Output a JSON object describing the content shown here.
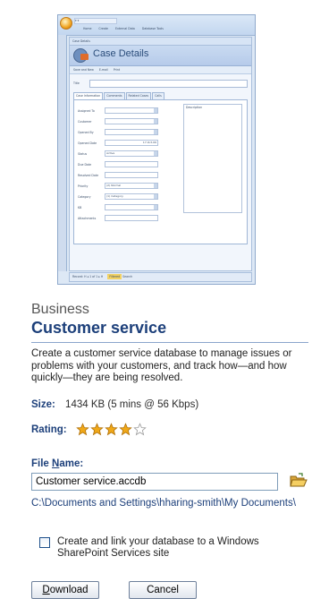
{
  "preview": {
    "quick_access": "▾ ▾",
    "ribbon_tabs": [
      "Home",
      "Create",
      "External Data",
      "Database Tools"
    ],
    "doc_tab": "Case Details",
    "form_title": "Case Details",
    "commands": [
      "Save and New",
      "E-mail",
      "Print"
    ],
    "title_label": "Title",
    "subtabs": [
      "Case Information",
      "Comments",
      "Related Cases",
      "Calls"
    ],
    "fields": [
      {
        "label": "Assigned To",
        "value": "",
        "dropdown": true
      },
      {
        "label": "Customer",
        "value": "",
        "dropdown": true
      },
      {
        "label": "Opened By",
        "value": "",
        "dropdown": true
      },
      {
        "label": "Opened Date",
        "value": "17-Oct-06",
        "dropdown": false
      },
      {
        "label": "Status",
        "value": "Active",
        "dropdown": true
      },
      {
        "label": "Due Date",
        "value": "",
        "dropdown": false
      },
      {
        "label": "Resolved Date",
        "value": "",
        "dropdown": false
      },
      {
        "label": "Priority",
        "value": "(2) Normal",
        "dropdown": true
      },
      {
        "label": "Category",
        "value": "(1) Category",
        "dropdown": true
      },
      {
        "label": "KB",
        "value": "",
        "dropdown": true
      },
      {
        "label": "Attachments",
        "value": "",
        "dropdown": false
      }
    ],
    "description_label": "Description",
    "record_nav": "Record: H ◂ 1 of 1 ▸ H",
    "filter_label": "Filtered",
    "search_label": "Search"
  },
  "template": {
    "category": "Business",
    "title": "Customer service",
    "description": "Create a customer service database to manage issues or problems with your customers, and track how—and how quickly—they are being resolved.",
    "size_label": "Size:",
    "size_value": "1434 KB (5 mins @ 56 Kbps)",
    "rating_label": "Rating:",
    "rating_stars": 4,
    "rating_max": 5,
    "file_name_label_pre": "File ",
    "file_name_label_underlined": "N",
    "file_name_label_post": "ame:",
    "file_name_value": "Customer service.accdb",
    "save_path": "C:\\Documents and Settings\\hharing-smith\\My Documents\\",
    "sharepoint_label": "Create and link your database to a Windows SharePoint Services site",
    "sharepoint_checked": false
  },
  "buttons": {
    "download_underlined": "D",
    "download_rest": "ownload",
    "cancel": "Cancel"
  },
  "colors": {
    "accent": "#1c3f7a",
    "star_fill": "#f0a818"
  },
  "icons": {
    "folder": "open-folder-icon",
    "star": "star-icon"
  }
}
